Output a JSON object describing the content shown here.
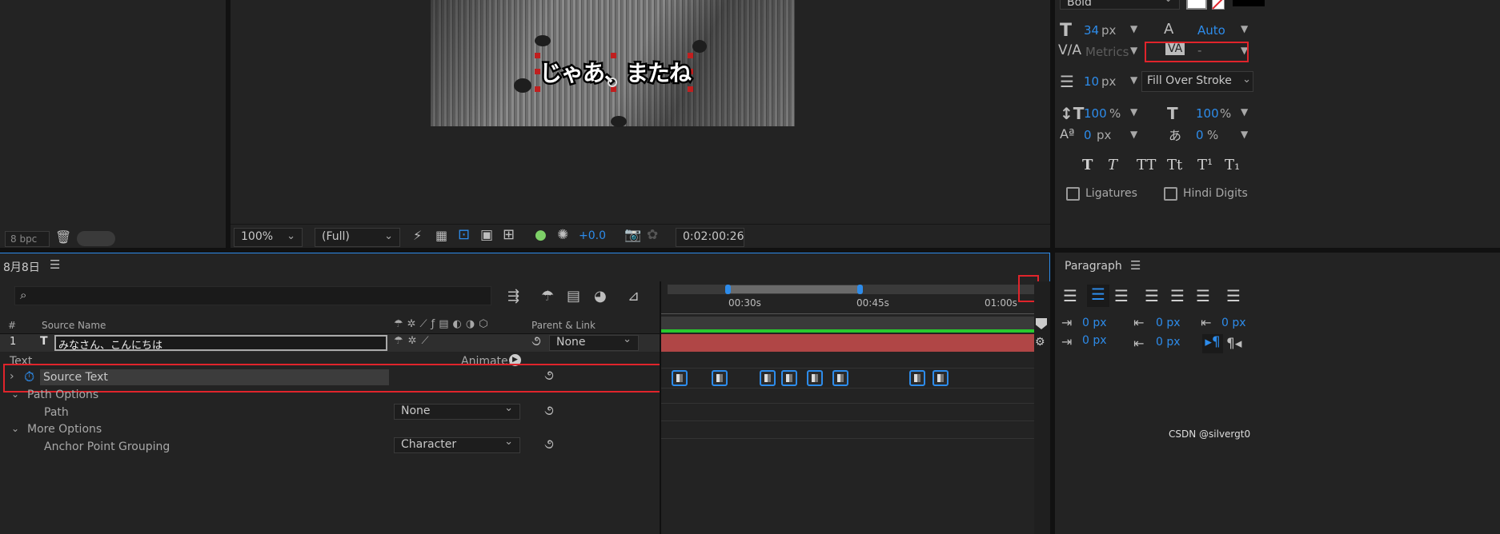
{
  "project": {
    "bpc": "8 bpc"
  },
  "viewer": {
    "subtitle_text": "じゃあ、またね",
    "zoom": "100%",
    "resolution": "(Full)",
    "exposure": "+0.0",
    "timecode": "0:02:00:26"
  },
  "character": {
    "font_style": "Bold",
    "font_size": "34",
    "font_size_unit": "px",
    "leading": "Auto",
    "kerning": "Metrics",
    "tracking": "-",
    "stroke_width": "10",
    "stroke_unit": "px",
    "stroke_mode": "Fill Over Stroke",
    "vert_scale": "100",
    "horiz_scale": "100",
    "pct": "%",
    "baseline_shift": "0",
    "baseline_unit": "px",
    "tsume": "0",
    "style_buttons": [
      "T",
      "T",
      "TT",
      "Tt",
      "T¹",
      "T₁"
    ],
    "ligatures_label": "Ligatures",
    "hindi_digits_label": "Hindi Digits"
  },
  "timeline": {
    "comp_name": "8月8日",
    "col_num": "#",
    "col_source_name": "Source Name",
    "col_parent": "Parent & Link",
    "layer_number": "1",
    "layer_type": "T",
    "layer_name": "みなさん、こんにちは",
    "parent_value": "None",
    "text_group": "Text",
    "animate_label": "Animate:",
    "source_text_label": "Source Text",
    "path_options_label": "Path Options",
    "path_label": "Path",
    "path_value": "None",
    "more_options_label": "More Options",
    "anchor_grouping_label": "Anchor Point Grouping",
    "anchor_grouping_value": "Character",
    "ruler_ticks": [
      "00:30s",
      "00:45s",
      "01:00s"
    ],
    "keyframe_positions": [
      0.7,
      5.3,
      11.0,
      13.5,
      16.5,
      19.5,
      28.5,
      31.2
    ]
  },
  "paragraph": {
    "title": "Paragraph",
    "indent_left": "0 px",
    "indent_first": "0 px",
    "indent_right": "0 px",
    "space_before": "0 px",
    "space_after": "0 px"
  },
  "watermark": "CSDN @silvergt0"
}
